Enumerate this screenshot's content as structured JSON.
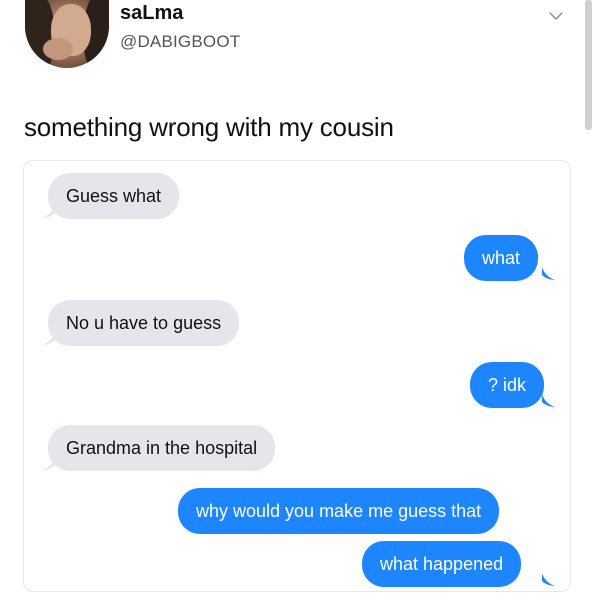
{
  "tweet": {
    "display_name": "saLma",
    "handle": "@DABIGBOOT",
    "text": "something wrong with my cousin"
  },
  "icons": {
    "avatar": "avatar",
    "menu": "chevron-down-icon"
  },
  "colors": {
    "incoming_bubble": "#e6e5eb",
    "outgoing_bubble": "#1d86ff"
  },
  "messages": [
    {
      "sender": "them",
      "text": "Guess what"
    },
    {
      "sender": "me",
      "text": "what"
    },
    {
      "sender": "them",
      "text": "No u have to guess"
    },
    {
      "sender": "me",
      "text": "? idk"
    },
    {
      "sender": "them",
      "text": "Grandma in the hospital"
    },
    {
      "sender": "me",
      "text": "why would you make me guess that"
    },
    {
      "sender": "me",
      "text": "what happened"
    }
  ]
}
